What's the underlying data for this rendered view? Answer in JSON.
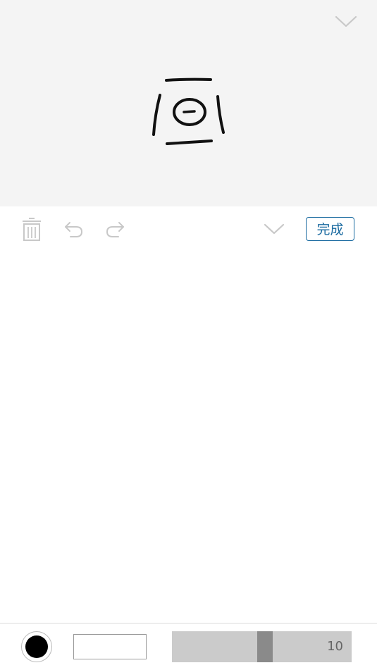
{
  "toolbar": {
    "done_label": "完成"
  },
  "icons": {
    "preview_chevron": "chevron-down-icon",
    "trash": "trash-icon",
    "undo": "undo-icon",
    "redo": "redo-icon",
    "collapse": "chevron-down-icon"
  },
  "pen": {
    "color": "#000000",
    "size_label": "10",
    "size_fraction": 0.52
  },
  "colors": {
    "accent": "#1a6aa0",
    "preview_bg": "#f4f4f4",
    "icon_gray": "#c8c8c8"
  }
}
